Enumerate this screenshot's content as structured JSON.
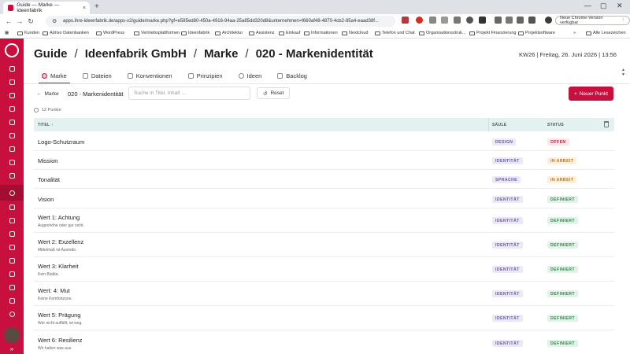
{
  "browser": {
    "tab_title": "Guide — Marke — Ideenfabrik",
    "url": "apps.ihre-ideenfabrik.de/apps-v2/guide/marke.php?gf=e585ed80-450a-4916-94aa-25a85dd320d8&unternehmen=f660af48-4870-4cb2-85a4-eaad38f...",
    "update_label": "Neue Chrome-Version verfügbar",
    "bookmarks": [
      "Kunden",
      "Adriso Datenbanken",
      "WordPress",
      "Vertriebsplattformen",
      "Ideenfabrik",
      "Architektur",
      "Assistenz",
      "Einkauf",
      "Informationen",
      "Nextcloud",
      "Telefon und Chat",
      "Organisationsstruk...",
      "Projekt Finanzierung",
      "Projektsoftware"
    ],
    "bookmarks_more": "Alle Lesezeichen"
  },
  "header": {
    "crumb_1": "Guide",
    "crumb_2": "Ideenfabrik GmbH",
    "crumb_3": "Marke",
    "crumb_4": "020 - Markenidentität",
    "sep": "/",
    "date": "KW26 | Freitag, 26. Juni 2026 | 13:56"
  },
  "tabs": [
    {
      "label": "Marke",
      "active": true
    },
    {
      "label": "Dateien",
      "active": false
    },
    {
      "label": "Konventionen",
      "active": false
    },
    {
      "label": "Prinzipien",
      "active": false
    },
    {
      "label": "Ideen",
      "active": false
    },
    {
      "label": "Backlog",
      "active": false
    }
  ],
  "toolbar": {
    "back_label": "Marke",
    "current_title": "020 - Markenidentität",
    "search_placeholder": "Suche in Titel, Inhalt ...",
    "reset_label": "Reset",
    "new_label": "Neuer Punkt"
  },
  "count_label": "12 Punkte",
  "table": {
    "col_title": "TITEL ↑",
    "col_pillar": "SÄULE",
    "col_status": "STATUS",
    "rows": [
      {
        "title": "Logo-Schutzraum",
        "sub": "",
        "pillar": "DESIGN",
        "status": "OFFEN",
        "status_kind": "offen"
      },
      {
        "title": "Mission",
        "sub": "",
        "pillar": "IDENTITÄT",
        "status": "IN ARBEIT",
        "status_kind": "arbeit"
      },
      {
        "title": "Tonalität",
        "sub": "",
        "pillar": "SPRACHE",
        "status": "IN ARBEIT",
        "status_kind": "arbeit"
      },
      {
        "title": "Vision",
        "sub": "",
        "pillar": "IDENTITÄT",
        "status": "DEFINIERT",
        "status_kind": "def"
      },
      {
        "title": "Wert 1: Achtung",
        "sub": "Augenhöhe oder gar nicht.",
        "pillar": "IDENTITÄT",
        "status": "DEFINIERT",
        "status_kind": "def"
      },
      {
        "title": "Wert 2: Exzellenz",
        "sub": "Mittelmaß ist Ausrede.",
        "pillar": "IDENTITÄT",
        "status": "DEFINIERT",
        "status_kind": "def"
      },
      {
        "title": "Wert 3: Klarheit",
        "sub": "Kein Blabla.",
        "pillar": "IDENTITÄT",
        "status": "DEFINIERT",
        "status_kind": "def"
      },
      {
        "title": "Wert: 4: Mut",
        "sub": "Keine Komfortzone.",
        "pillar": "IDENTITÄT",
        "status": "DEFINIERT",
        "status_kind": "def"
      },
      {
        "title": "Wert 5: Prägung",
        "sub": "Wer nicht auffällt, ist weg.",
        "pillar": "IDENTITÄT",
        "status": "DEFINIERT",
        "status_kind": "def"
      },
      {
        "title": "Wert 6: Resilienz",
        "sub": "Wir halten was aus.",
        "pillar": "IDENTITÄT",
        "status": "DEFINIERT",
        "status_kind": "def"
      }
    ]
  },
  "colors": {
    "brand": "#c8103e",
    "header_row": "#e3f1f0"
  }
}
